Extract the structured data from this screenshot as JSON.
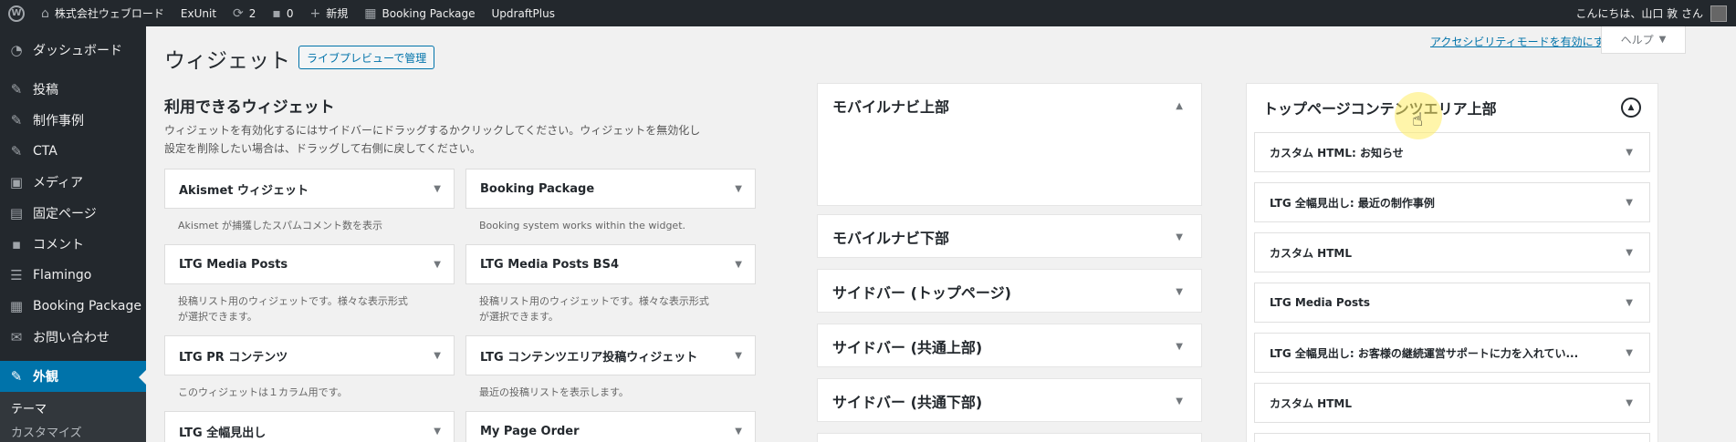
{
  "adminbar": {
    "site_name": "株式会社ウェブロード",
    "exunit": "ExUnit",
    "updates": "2",
    "comments": "0",
    "new_label": "新規",
    "booking": "Booking Package",
    "updraft": "UpdraftPlus",
    "greeting": "こんにちは、山口 敦 さん"
  },
  "sidebar": {
    "items": [
      {
        "label": "ダッシュボード",
        "icon": "dashboard-icon"
      },
      {
        "label": "投稿",
        "icon": "pin-icon"
      },
      {
        "label": "制作事例",
        "icon": "pin-icon"
      },
      {
        "label": "CTA",
        "icon": "pin-icon"
      },
      {
        "label": "メディア",
        "icon": "media-icon"
      },
      {
        "label": "固定ページ",
        "icon": "page-icon"
      },
      {
        "label": "コメント",
        "icon": "comment-icon"
      },
      {
        "label": "Flamingo",
        "icon": "flamingo-icon"
      },
      {
        "label": "Booking Package",
        "icon": "calendar-icon"
      },
      {
        "label": "お問い合わせ",
        "icon": "mail-icon"
      },
      {
        "label": "外観",
        "icon": "appearance-icon"
      }
    ],
    "submenu": [
      "テーマ",
      "カスタマイズ"
    ]
  },
  "header": {
    "title": "ウィジェット",
    "preview_button": "ライブプレビューで管理",
    "a11y_link": "アクセシビリティモードを有効にする",
    "help": "ヘルプ"
  },
  "available": {
    "title": "利用できるウィジェット",
    "desc_line1": "ウィジェットを有効化するにはサイドバーにドラッグするかクリックしてください。ウィジェットを無効化し",
    "desc_line2": "設定を削除したい場合は、ドラッグして右側に戻してください。",
    "col1": [
      {
        "name": "Akismet ウィジェット",
        "desc": "Akismet が捕獲したスパムコメント数を表示"
      },
      {
        "name": "LTG Media Posts",
        "desc": "投稿リスト用のウィジェットです。様々な表示形式",
        "desc2": "が選択できます。"
      },
      {
        "name": "LTG PR コンテンツ",
        "desc": "このウィジェットは１カラム用です。"
      },
      {
        "name": "LTG 全幅見出し"
      }
    ],
    "col2": [
      {
        "name": "Booking Package",
        "desc": "Booking system works within the widget."
      },
      {
        "name": "LTG Media Posts BS4",
        "desc": "投稿リスト用のウィジェットです。様々な表示形式",
        "desc2": "が選択できます。"
      },
      {
        "name": "LTG コンテンツエリア投稿ウィジェット",
        "desc": "最近の投稿リストを表示します。"
      },
      {
        "name": "My Page Order"
      }
    ]
  },
  "sidebars": [
    "モバイルナビ上部",
    "モバイルナビ下部",
    "サイドバー (トップページ)",
    "サイドバー (共通上部)",
    "サイドバー (共通下部)"
  ],
  "top_area": {
    "title": "トップページコンテンツエリア上部",
    "widgets": [
      "カスタム HTML: お知らせ",
      "LTG 全幅見出し: 最近の制作事例",
      "カスタム HTML",
      "LTG Media Posts",
      "LTG 全幅見出し: お客様の継続運営サポートに力を入れてい...",
      "カスタム HTML"
    ]
  }
}
